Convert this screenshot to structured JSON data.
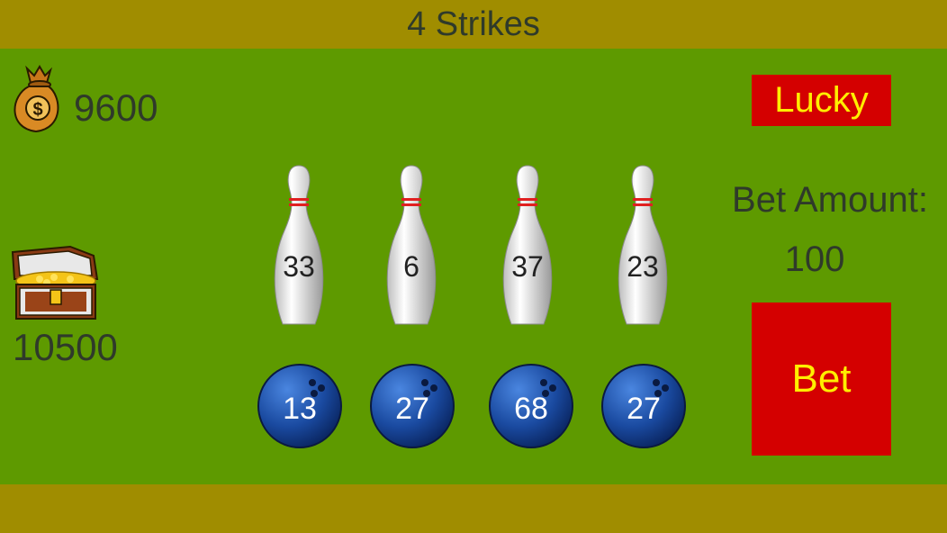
{
  "title": "4 Strikes",
  "money": {
    "icon": "money-bag-icon",
    "value": "9600"
  },
  "treasure": {
    "icon": "treasure-chest-icon",
    "value": "10500"
  },
  "pins": [
    {
      "icon": "bowling-pin-icon",
      "number": "33"
    },
    {
      "icon": "bowling-pin-icon",
      "number": "6"
    },
    {
      "icon": "bowling-pin-icon",
      "number": "37"
    },
    {
      "icon": "bowling-pin-icon",
      "number": "23"
    }
  ],
  "balls": [
    {
      "icon": "bowling-ball-icon",
      "number": "13"
    },
    {
      "icon": "bowling-ball-icon",
      "number": "27"
    },
    {
      "icon": "bowling-ball-icon",
      "number": "68"
    },
    {
      "icon": "bowling-ball-icon",
      "number": "27"
    }
  ],
  "lucky_label": "Lucky",
  "bet_label": "Bet Amount:",
  "bet_amount": "100",
  "bet_button": "Bet",
  "colors": {
    "field": "#5e9a00",
    "bars": "#a08d00",
    "button": "#d40000",
    "button_text": "#ffee00",
    "ball": "#1a4aa0"
  }
}
